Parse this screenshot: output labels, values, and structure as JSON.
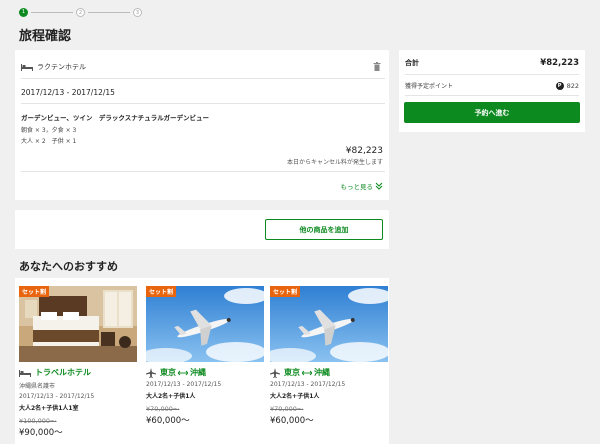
{
  "stepper": {
    "steps": [
      "1",
      "2",
      "3"
    ]
  },
  "page_title": "旅程確認",
  "booking": {
    "hotel_name": "ラクテンホテル",
    "date_range": "2017/12/13 - 2017/12/15",
    "room": "ガーデンビュー、ツイン　デラックスナチュラルガーデンビュー",
    "meals": "朝食 × 3，夕食 × 3",
    "guests": "大人 × 2　子供 × 1",
    "price": "¥82,223",
    "cancel_note": "本日からキャンセル料が発生します",
    "more_label": "もっと見る"
  },
  "add_button_label": "他の商品を追加",
  "recommend_title": "あなたへのおすすめ",
  "recommendations": [
    {
      "badge": "セット割",
      "title": "トラベルホテル",
      "location": "沖縄県名護市",
      "dates": "2017/12/13 - 2017/12/15",
      "guests": "大人2名+子供1人1室",
      "original": "¥100,000〜",
      "price": "¥90,000〜"
    },
    {
      "badge": "セット割",
      "from": "東京",
      "to": "沖縄",
      "dates": "2017/12/13 - 2017/12/15",
      "guests": "大人2名+子供1人",
      "original": "¥70,000〜",
      "price": "¥60,000〜"
    },
    {
      "badge": "セット割",
      "from": "東京",
      "to": "沖縄",
      "dates": "2017/12/13 - 2017/12/15",
      "guests": "大人2名+子供1人",
      "original": "¥70,000〜",
      "price": "¥60,000〜"
    }
  ],
  "summary": {
    "total_label": "合計",
    "total_value": "¥82,223",
    "points_label": "獲得予定ポイント",
    "points_icon": "P",
    "points_value": "822",
    "reserve_label": "予約へ進む"
  },
  "colors": {
    "accent": "#0d8a1f",
    "badge": "#e8650d"
  }
}
